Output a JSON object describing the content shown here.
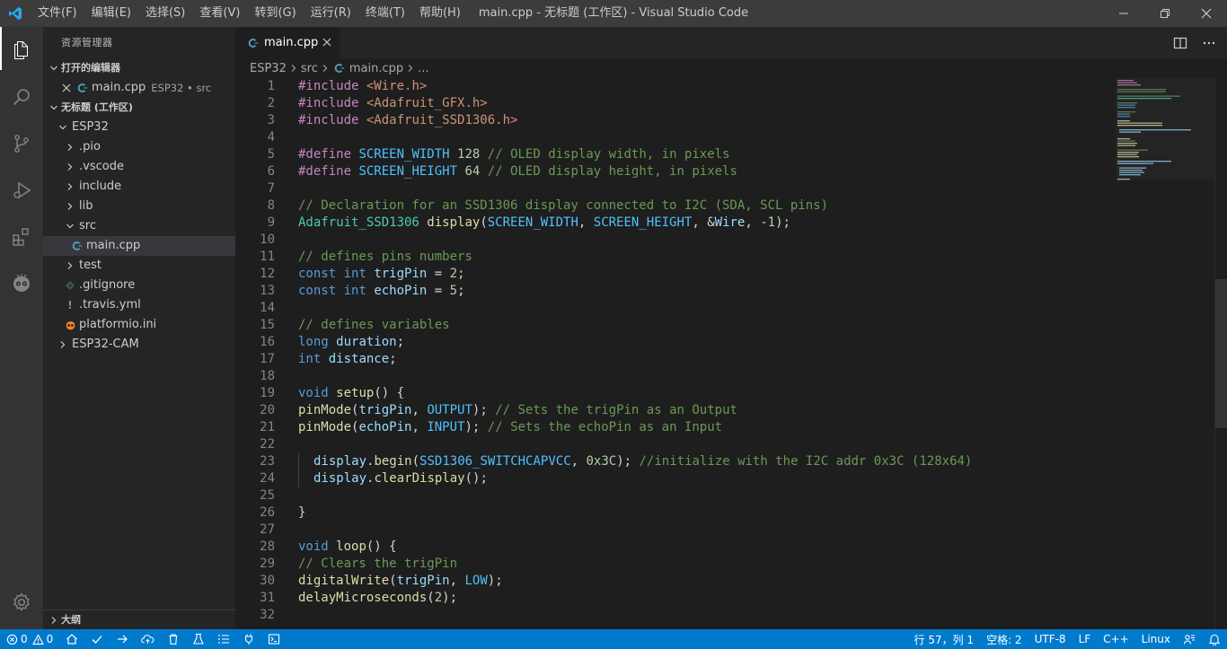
{
  "window": {
    "title": "main.cpp - 无标题 (工作区) - Visual Studio Code",
    "menu": [
      "文件(F)",
      "编辑(E)",
      "选择(S)",
      "查看(V)",
      "转到(G)",
      "运行(R)",
      "终端(T)",
      "帮助(H)"
    ]
  },
  "activitybar": {
    "items": [
      "explorer-icon",
      "search-icon",
      "source-control-icon",
      "run-debug-icon",
      "extensions-icon",
      "platformio-icon"
    ],
    "bottom": "settings-gear-icon"
  },
  "sidebar": {
    "title": "资源管理器",
    "open_editors_header": "打开的编辑器",
    "open_editor": {
      "name": "main.cpp",
      "desc": "ESP32 • src"
    },
    "workspace_header": "无标题 (工作区)",
    "tree": {
      "esp32": "ESP32",
      "pio": ".pio",
      "vscode": ".vscode",
      "include": "include",
      "lib": "lib",
      "src": "src",
      "main_cpp": "main.cpp",
      "test": "test",
      "gitignore": ".gitignore",
      "travis": ".travis.yml",
      "platformio": "platformio.ini",
      "esp32cam": "ESP32-CAM"
    },
    "outline_header": "大纲"
  },
  "editor": {
    "tab_label": "main.cpp",
    "breadcrumb": [
      "ESP32",
      "src",
      "main.cpp",
      "..."
    ],
    "line_numbers": [
      "1",
      "2",
      "3",
      "4",
      "5",
      "6",
      "7",
      "8",
      "9",
      "10",
      "11",
      "12",
      "13",
      "14",
      "15",
      "16",
      "17",
      "18",
      "19",
      "20",
      "21",
      "22",
      "23",
      "24",
      "25",
      "26",
      "27",
      "28",
      "29",
      "30",
      "31",
      "32"
    ],
    "code": {
      "l1": [
        "#include",
        "<Wire.h>"
      ],
      "l2": [
        "#include",
        "<Adafruit_GFX.h>"
      ],
      "l3": [
        "#include",
        "<Adafruit_SSD1306.h>"
      ],
      "l5": [
        "#define",
        "SCREEN_WIDTH",
        "128",
        "// OLED display width, in pixels"
      ],
      "l6": [
        "#define",
        "SCREEN_HEIGHT",
        "64",
        "// OLED display height, in pixels"
      ],
      "l8": "// Declaration for an SSD1306 display connected to I2C (SDA, SCL pins)",
      "l9": [
        "Adafruit_SSD1306",
        "display",
        "(",
        "SCREEN_WIDTH",
        ", ",
        "SCREEN_HEIGHT",
        ", &",
        "Wire",
        ", ",
        "-1",
        ");"
      ],
      "l11": "// defines pins numbers",
      "l12": [
        "const",
        "int",
        "trigPin",
        " = ",
        "2",
        ";"
      ],
      "l13": [
        "const",
        "int",
        "echoPin",
        " = ",
        "5",
        ";"
      ],
      "l15": "// defines variables",
      "l16": [
        "long",
        "duration",
        ";"
      ],
      "l17": [
        "int",
        "distance",
        ";"
      ],
      "l19": [
        "void",
        "setup",
        "() {"
      ],
      "l20": [
        "pinMode",
        "(",
        "trigPin",
        ", ",
        "OUTPUT",
        "); ",
        "// Sets the trigPin as an Output"
      ],
      "l21": [
        "pinMode",
        "(",
        "echoPin",
        ", ",
        "INPUT",
        "); ",
        "// Sets the echoPin as an Input"
      ],
      "l23": [
        "display",
        ".",
        "begin",
        "(",
        "SSD1306_SWITCHCAPVCC",
        ", ",
        "0x3C",
        "); ",
        "//initialize with the I2C addr 0x3C (128x64)"
      ],
      "l24": [
        "display",
        ".",
        "clearDisplay",
        "();"
      ],
      "l26": "}",
      "l28": [
        "void",
        "loop",
        "() {"
      ],
      "l29": "// Clears the trigPin",
      "l30": [
        "digitalWrite",
        "(",
        "trigPin",
        ", ",
        "LOW",
        ");"
      ],
      "l31": [
        "delayMicroseconds",
        "(",
        "2",
        ");"
      ]
    }
  },
  "statusbar": {
    "errors": "0",
    "warnings": "0",
    "position": "行 57，列 1",
    "spaces": "空格: 2",
    "encoding": "UTF-8",
    "eol": "LF",
    "language": "C++",
    "platform": "Linux"
  },
  "colors": {
    "accent": "#007acc",
    "titlebar": "#3c3c3c",
    "activitybar": "#333333",
    "sidebar": "#252526",
    "editor": "#1e1e1e"
  }
}
